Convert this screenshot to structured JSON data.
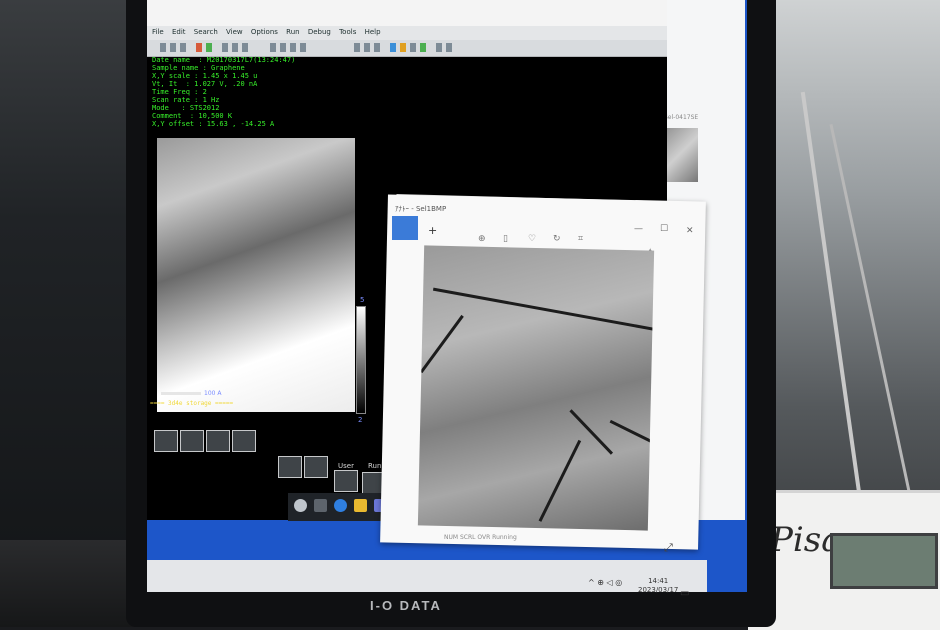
{
  "scene": {
    "device_label": "Pisa",
    "monitor_brand": "I-O DATA"
  },
  "main_window": {
    "menu_items": [
      "File",
      "Edit",
      "Search",
      "View",
      "Options",
      "Run",
      "Debug",
      "Tools",
      "Help"
    ],
    "parameters": [
      "Date name  : M20170317L7(13:24:47)",
      "Sample name : Graphene",
      "X,Y scale : 1.45 x 1.45 u",
      "Vt, It  : 1.027 V, .20 nA",
      "Time Freq : 2",
      "Scan rate : 1 Hz",
      "Mode   : STS2012",
      "Comment  : 10,500 K",
      "X,Y offset : 15.63 , -14.25 A"
    ],
    "scale_label": "100 A",
    "colorbar_top": "5",
    "colorbar_bottom": "2",
    "status_line": "==== 3d4e storage =====",
    "user_label": "User",
    "run_label": "Run"
  },
  "photo_viewer": {
    "title": "ｱﾅﾄｰ - Sel1BMP"
  },
  "right_window": {
    "thumb_label": "Sel-0417SE"
  },
  "taskbar": {
    "status_text": "NUM SCRL OVR Running",
    "time": "14:41",
    "date": "2023/03/17"
  },
  "colors": {
    "taskbar_accent": "#1d56c9",
    "terminal_text": "#37f02a",
    "label_blue": "#7b8dff"
  }
}
